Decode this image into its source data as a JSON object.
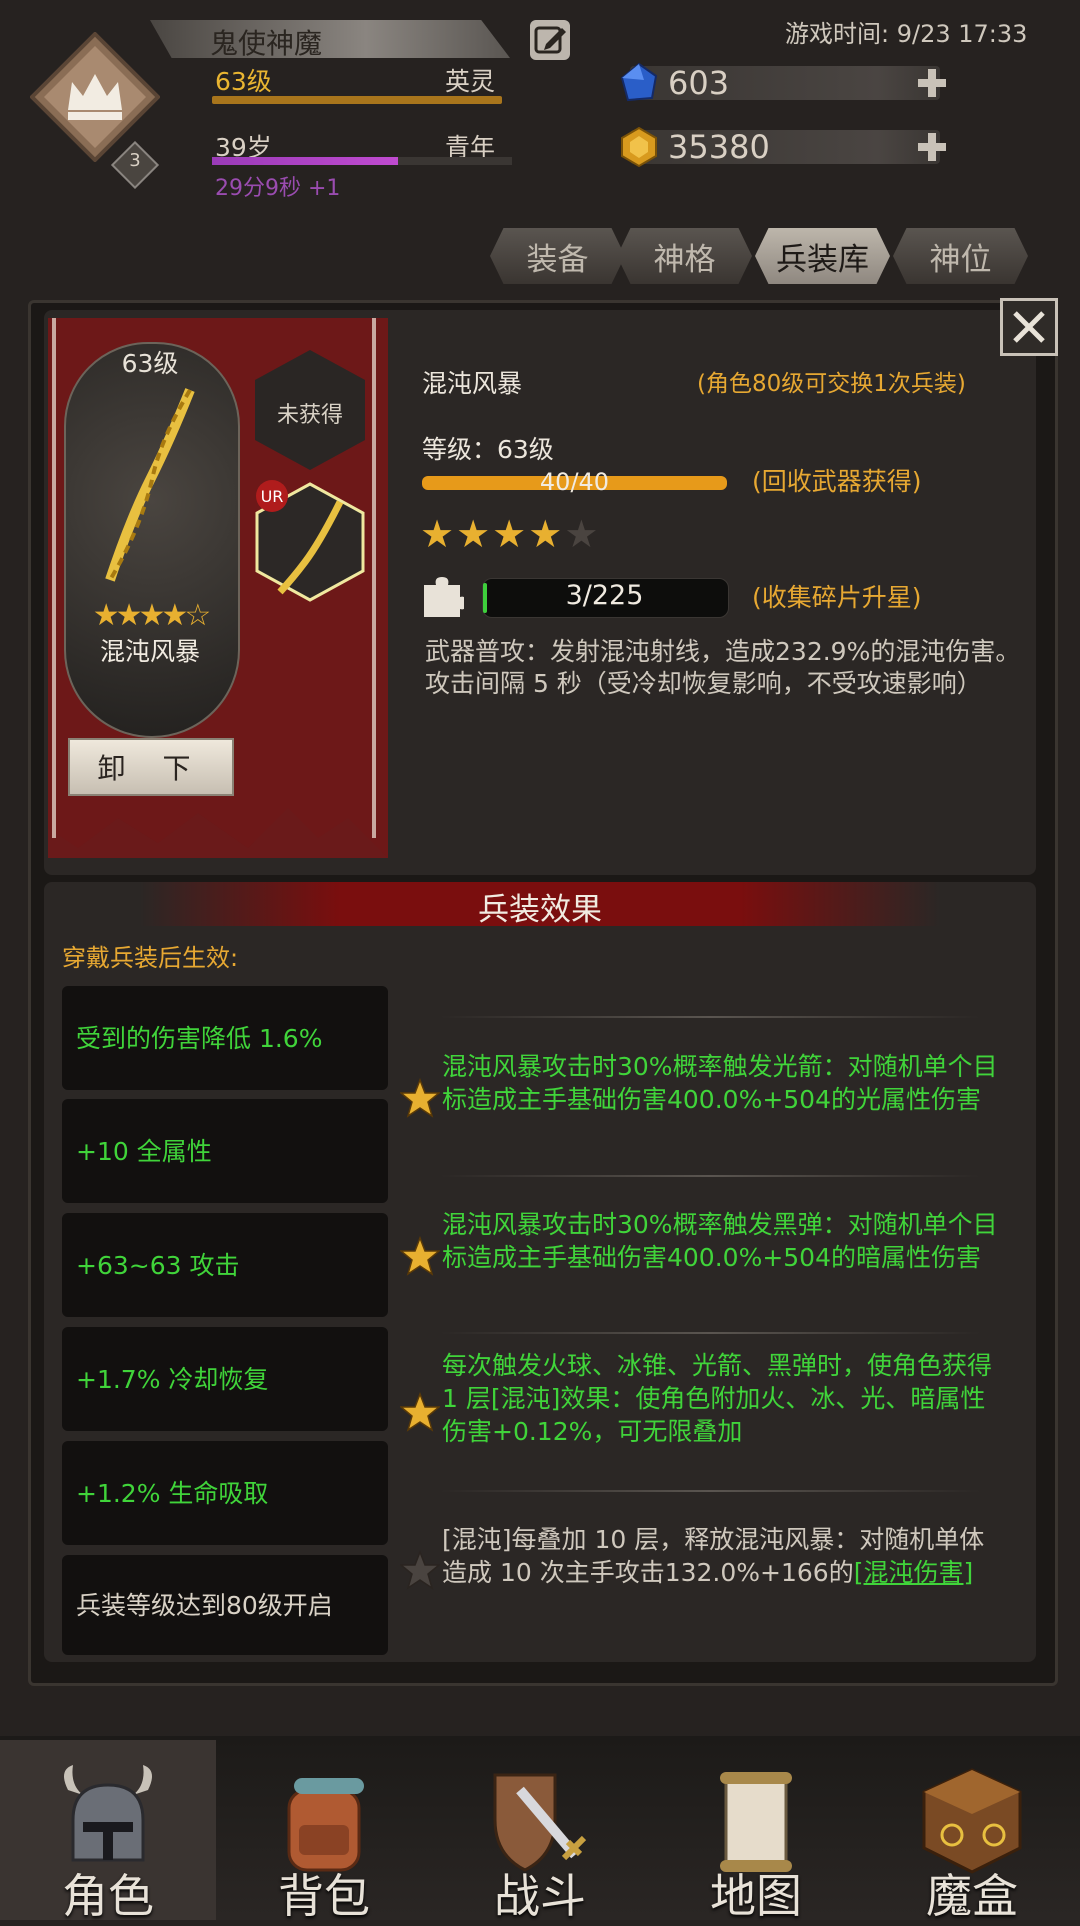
{
  "header": {
    "player_name": "鬼使神魔",
    "game_time": "游戏时间: 9/23 17:33",
    "level": "63级",
    "title": "英灵",
    "age": "39岁",
    "age_stage": "青年",
    "age_progress": 0.62,
    "age_timer": "29分9秒 +1",
    "rank_number": "3",
    "resources": [
      {
        "icon": "blue-gem-icon",
        "value": "603"
      },
      {
        "icon": "gold-gem-icon",
        "value": "35380"
      }
    ]
  },
  "tabs": [
    {
      "label": "装备",
      "active": false
    },
    {
      "label": "神格",
      "active": false
    },
    {
      "label": "兵装库",
      "active": true
    },
    {
      "label": "神位",
      "active": false
    }
  ],
  "weapon_card": {
    "level": "63级",
    "name": "混沌风暴",
    "stars": "★★★★☆",
    "unequip_label": "卸 下",
    "slot_locked_label": "未获得",
    "slot_rarity": "UR"
  },
  "weapon_info": {
    "name": "混沌风暴",
    "exchange_note": "(角色80级可交换1次兵装)",
    "level_label": "等级：63级",
    "exp_text": "40/40",
    "exp_progress": 1.0,
    "exp_hint": "(回收武器获得)",
    "stars_filled": 4,
    "stars_total": 5,
    "fragment_text": "3/225",
    "fragment_progress": 0.0133,
    "fragment_hint": "(收集碎片升星)",
    "skill_desc": "武器普攻：发射混沌射线，造成232.9%的混沌伤害。攻击间隔 5 秒（受冷却恢复影响，不受攻速影响）"
  },
  "effects": {
    "title": "兵装效果",
    "wear_note": "穿戴兵装后生效:",
    "attributes": [
      {
        "text": "受到的伤害降低 1.6%",
        "unlocked": true
      },
      {
        "text": "+10 全属性",
        "unlocked": true
      },
      {
        "text": "+63~63 攻击",
        "unlocked": true
      },
      {
        "text": "+1.7% 冷却恢复",
        "unlocked": true
      },
      {
        "text": "+1.2% 生命吸取",
        "unlocked": true
      },
      {
        "text": "兵装等级达到80级开启",
        "unlocked": false
      }
    ],
    "passives": [
      {
        "text": "混沌风暴攻击时30%概率触发光箭：对随机单个目标造成主手基础伤害400.0%+504的光属性伤害",
        "active": true
      },
      {
        "text": "混沌风暴攻击时30%概率触发黑弹：对随机单个目标造成主手基础伤害400.0%+504的暗属性伤害",
        "active": true
      },
      {
        "text": "每次触发火球、冰锥、光箭、黑弹时，使角色获得 1 层[混沌]效果：使角色附加火、冰、光、暗属性伤害+0.12%，可无限叠加",
        "active": true
      },
      {
        "text": "[混沌]每叠加 10 层，释放混沌风暴：对随机单体造成 10 次主手攻击132.0%+166的",
        "link": "[混沌伤害]",
        "active": false
      }
    ]
  },
  "nav": [
    {
      "label": "角色",
      "icon": "helmet-icon",
      "active": true
    },
    {
      "label": "背包",
      "icon": "backpack-icon",
      "active": false
    },
    {
      "label": "战斗",
      "icon": "sword-shield-icon",
      "active": false
    },
    {
      "label": "地图",
      "icon": "map-scroll-icon",
      "active": false
    },
    {
      "label": "魔盒",
      "icon": "magic-box-icon",
      "active": false
    }
  ],
  "colors": {
    "accent_gold": "#e7a832",
    "effect_green": "#40d43a",
    "banner_red": "#6a1a1a"
  }
}
